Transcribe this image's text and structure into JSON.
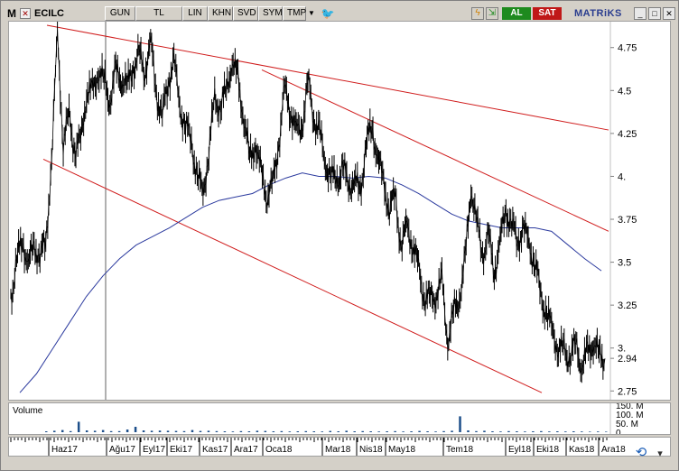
{
  "toolbar": {
    "logo": "M",
    "symbol": "ECILC",
    "period_button": "GUN",
    "currency_button": "TL",
    "scale_button": "LIN",
    "khn_button": "KHN",
    "svd_button": "SVD",
    "sym_button": "SYM",
    "tmp_button": "TMP",
    "buy_button": "AL",
    "sell_button": "SAT",
    "brand": "MATRiKS",
    "icons": [
      "close-icon",
      "dropdown-arrow-icon",
      "twitter-bird-icon",
      "lightning-icon",
      "export-icon",
      "minimize-icon",
      "restore-icon",
      "close-window-icon"
    ]
  },
  "colors": {
    "price_line": "#000000",
    "moving_average": "#2b3a9e",
    "trend_channel": "#d01c1c",
    "volume_bar": "#1d4f8a",
    "al_bg": "#1e8a1e",
    "sat_bg": "#c01818"
  },
  "chart_data": {
    "type": "line",
    "y_axis": {
      "ticks": [
        "4.75",
        "4.5",
        "4.25",
        "4.",
        "3.75",
        "3.5",
        "3.25",
        "3.",
        "2.94",
        "2.75"
      ],
      "range": [
        2.72,
        4.88
      ],
      "last_value": "2.94"
    },
    "x_axis": {
      "ticks": [
        "Haz17",
        "Ağu17",
        "Eyl17",
        "Eki17",
        "Kas17",
        "Ara17",
        "Oca18",
        "Mar18",
        "Nis18",
        "May18",
        "Tem18",
        "Eyl18",
        "Eki18",
        "Kas18",
        "Ara18"
      ]
    },
    "price_series": {
      "name": "ECILC",
      "values": [
        3.28,
        3.52,
        3.62,
        3.5,
        3.58,
        3.55,
        3.6,
        4.1,
        4.82,
        4.2,
        4.35,
        4.15,
        4.2,
        4.5,
        4.48,
        4.62,
        4.55,
        4.45,
        4.6,
        4.58,
        4.52,
        4.64,
        4.7,
        4.62,
        4.78,
        4.48,
        4.35,
        4.55,
        4.68,
        4.4,
        4.3,
        4.2,
        4.0,
        3.9,
        4.15,
        4.45,
        4.4,
        4.5,
        4.68,
        4.55,
        4.35,
        4.1,
        4.2,
        4.0,
        3.9,
        3.95,
        4.2,
        4.5,
        4.4,
        4.25,
        4.3,
        4.55,
        4.35,
        4.25,
        4.08,
        4.0,
        3.98,
        4.05,
        3.95,
        3.98,
        3.9,
        4.2,
        4.28,
        4.12,
        3.95,
        3.82,
        3.88,
        3.6,
        3.7,
        3.62,
        3.45,
        3.3,
        3.28,
        3.32,
        3.38,
        3.05,
        3.2,
        3.3,
        3.5,
        3.95,
        3.72,
        3.55,
        3.65,
        3.45,
        3.62,
        3.8,
        3.72,
        3.62,
        3.7,
        3.6,
        3.5,
        3.3,
        3.2,
        3.1,
        3.0,
        2.98,
        2.95,
        3.02,
        2.9,
        2.96,
        3.05,
        2.95,
        2.94
      ]
    },
    "moving_average": {
      "values": [
        2.74,
        2.85,
        3.0,
        3.15,
        3.3,
        3.42,
        3.52,
        3.6,
        3.65,
        3.7,
        3.76,
        3.82,
        3.86,
        3.88,
        3.9,
        3.95,
        3.99,
        4.02,
        4.0,
        4.0,
        3.99,
        4.0,
        3.99,
        3.95,
        3.9,
        3.84,
        3.78,
        3.74,
        3.72,
        3.7,
        3.7,
        3.7,
        3.68,
        3.6,
        3.52,
        3.45
      ]
    },
    "trend_channel": {
      "upper_line_1": [
        [
          0,
          4.88
        ],
        [
          1,
          4.27
        ]
      ],
      "upper_line_2": [
        [
          0,
          4.62
        ],
        [
          1,
          3.68
        ]
      ],
      "lower_line": [
        [
          0,
          4.1
        ],
        [
          1,
          2.74
        ]
      ]
    },
    "volume": {
      "label": "Volume",
      "ticks": [
        "150. M",
        "100. M",
        "50. M",
        "0"
      ],
      "bars": [
        5,
        8,
        12,
        6,
        58,
        10,
        8,
        12,
        6,
        6,
        15,
        30,
        10,
        8,
        9,
        8,
        7,
        6,
        12,
        7,
        8,
        6,
        5,
        4,
        6,
        5,
        8,
        7,
        5,
        6,
        4,
        5,
        6,
        5,
        4,
        7,
        5,
        8,
        5,
        6,
        5,
        4,
        5,
        6,
        4,
        5,
        7,
        5,
        4,
        6,
        8,
        88,
        10,
        6,
        8,
        5,
        4,
        6,
        5,
        4,
        5,
        6,
        4,
        5,
        4,
        5,
        4,
        3,
        4,
        3
      ]
    }
  }
}
